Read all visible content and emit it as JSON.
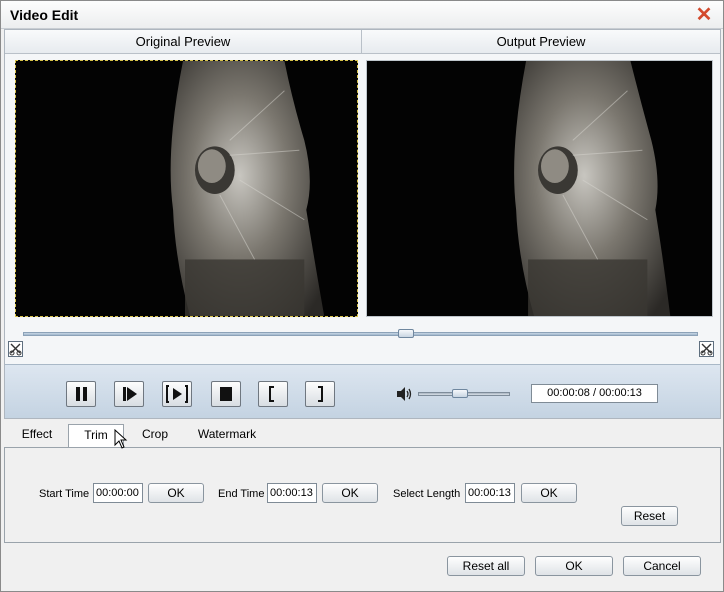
{
  "window": {
    "title": "Video Edit",
    "close_icon": "close-icon"
  },
  "preview": {
    "original_label": "Original Preview",
    "output_label": "Output Preview"
  },
  "timeline": {
    "position": 0.57
  },
  "player": {
    "volume": 0.45,
    "time_display": "00:00:08 / 00:00:13"
  },
  "tabs": [
    {
      "label": "Effect",
      "active": false
    },
    {
      "label": "Trim",
      "active": true
    },
    {
      "label": "Crop",
      "active": false
    },
    {
      "label": "Watermark",
      "active": false
    }
  ],
  "trim": {
    "start_label": "Start Time",
    "start_value": "00:00:00",
    "end_label": "End Time",
    "end_value": "00:00:13",
    "length_label": "Select Length",
    "length_value": "00:00:13",
    "ok_label": "OK",
    "reset_label": "Reset"
  },
  "footer": {
    "reset_all_label": "Reset all",
    "ok_label": "OK",
    "cancel_label": "Cancel"
  },
  "colors": {
    "accent": "#c4d3e2",
    "close": "#d34a2d",
    "selection_border": "#d7c34a"
  }
}
